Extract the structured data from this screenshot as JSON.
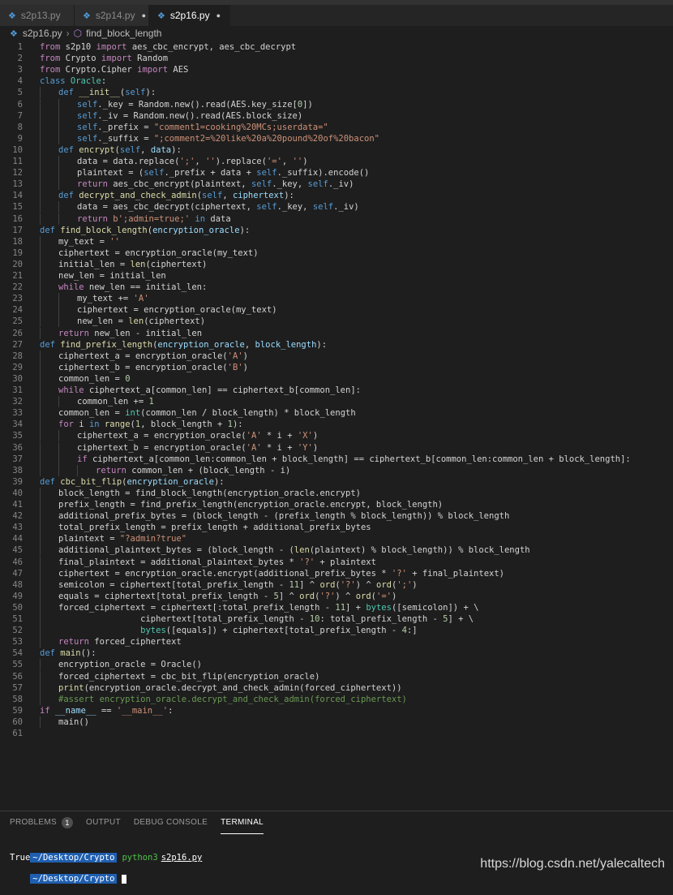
{
  "tabs": [
    {
      "label": "s2p13.py",
      "modified": false,
      "active": false
    },
    {
      "label": "s2p14.py",
      "modified": true,
      "active": false
    },
    {
      "label": "s2p16.py",
      "modified": true,
      "active": true
    }
  ],
  "breadcrumb": {
    "file": "s2p16.py",
    "symbol": "find_block_length"
  },
  "code_lines": [
    {
      "n": 1,
      "indent": 0,
      "tokens": [
        [
          "kw",
          "from"
        ],
        [
          "op",
          " s2p10 "
        ],
        [
          "kw",
          "import"
        ],
        [
          "op",
          " aes_cbc_encrypt, aes_cbc_decrypt"
        ]
      ]
    },
    {
      "n": 2,
      "indent": 0,
      "tokens": [
        [
          "kw",
          "from"
        ],
        [
          "op",
          " Crypto "
        ],
        [
          "kw",
          "import"
        ],
        [
          "op",
          " Random"
        ]
      ]
    },
    {
      "n": 3,
      "indent": 0,
      "tokens": [
        [
          "kw",
          "from"
        ],
        [
          "op",
          " Crypto.Cipher "
        ],
        [
          "kw",
          "import"
        ],
        [
          "op",
          " AES"
        ]
      ]
    },
    {
      "n": 4,
      "indent": 0,
      "tokens": [
        [
          "kw2",
          "class"
        ],
        [
          "cls",
          " Oracle"
        ],
        [
          "op",
          ":"
        ]
      ]
    },
    {
      "n": 5,
      "indent": 1,
      "tokens": [
        [
          "kw2",
          "def"
        ],
        [
          "fn",
          " __init__"
        ],
        [
          "op",
          "("
        ],
        [
          "self",
          "self"
        ],
        [
          "op",
          "):"
        ]
      ]
    },
    {
      "n": 6,
      "indent": 2,
      "tokens": [
        [
          "self",
          "self"
        ],
        [
          "op",
          "._key = Random.new().read(AES.key_size["
        ],
        [
          "num",
          "0"
        ],
        [
          "op",
          "])"
        ]
      ]
    },
    {
      "n": 7,
      "indent": 2,
      "tokens": [
        [
          "self",
          "self"
        ],
        [
          "op",
          "._iv = Random.new().read(AES.block_size)"
        ]
      ]
    },
    {
      "n": 8,
      "indent": 2,
      "tokens": [
        [
          "self",
          "self"
        ],
        [
          "op",
          "._prefix = "
        ],
        [
          "str",
          "\"comment1=cooking%20MCs;userdata=\""
        ]
      ]
    },
    {
      "n": 9,
      "indent": 2,
      "tokens": [
        [
          "self",
          "self"
        ],
        [
          "op",
          "._suffix = "
        ],
        [
          "str",
          "\";comment2=%20like%20a%20pound%20of%20bacon\""
        ]
      ]
    },
    {
      "n": 10,
      "indent": 1,
      "tokens": [
        [
          "kw2",
          "def"
        ],
        [
          "fn",
          " encrypt"
        ],
        [
          "op",
          "("
        ],
        [
          "self",
          "self"
        ],
        [
          "op",
          ", "
        ],
        [
          "var",
          "data"
        ],
        [
          "op",
          "):"
        ]
      ]
    },
    {
      "n": 11,
      "indent": 2,
      "tokens": [
        [
          "op",
          "data = data.replace("
        ],
        [
          "str",
          "';'"
        ],
        [
          "op",
          ", "
        ],
        [
          "str",
          "''"
        ],
        [
          "op",
          ").replace("
        ],
        [
          "str",
          "'='"
        ],
        [
          "op",
          ", "
        ],
        [
          "str",
          "''"
        ],
        [
          "op",
          ")"
        ]
      ]
    },
    {
      "n": 12,
      "indent": 2,
      "tokens": [
        [
          "op",
          "plaintext = ("
        ],
        [
          "self",
          "self"
        ],
        [
          "op",
          "._prefix + data + "
        ],
        [
          "self",
          "self"
        ],
        [
          "op",
          "._suffix).encode()"
        ]
      ]
    },
    {
      "n": 13,
      "indent": 2,
      "tokens": [
        [
          "kw",
          "return"
        ],
        [
          "op",
          " aes_cbc_encrypt(plaintext, "
        ],
        [
          "self",
          "self"
        ],
        [
          "op",
          "._key, "
        ],
        [
          "self",
          "self"
        ],
        [
          "op",
          "._iv)"
        ]
      ]
    },
    {
      "n": 14,
      "indent": 1,
      "tokens": [
        [
          "kw2",
          "def"
        ],
        [
          "fn",
          " decrypt_and_check_admin"
        ],
        [
          "op",
          "("
        ],
        [
          "self",
          "self"
        ],
        [
          "op",
          ", "
        ],
        [
          "var",
          "ciphertext"
        ],
        [
          "op",
          "):"
        ]
      ]
    },
    {
      "n": 15,
      "indent": 2,
      "tokens": [
        [
          "op",
          "data = aes_cbc_decrypt(ciphertext, "
        ],
        [
          "self",
          "self"
        ],
        [
          "op",
          "._key, "
        ],
        [
          "self",
          "self"
        ],
        [
          "op",
          "._iv)"
        ]
      ]
    },
    {
      "n": 16,
      "indent": 2,
      "tokens": [
        [
          "kw",
          "return"
        ],
        [
          "op",
          " "
        ],
        [
          "str",
          "b';admin=true;'"
        ],
        [
          "op",
          " "
        ],
        [
          "kw2",
          "in"
        ],
        [
          "op",
          " data"
        ]
      ]
    },
    {
      "n": 17,
      "indent": 0,
      "tokens": [
        [
          "kw2",
          "def"
        ],
        [
          "fn",
          " find_block_length"
        ],
        [
          "op",
          "("
        ],
        [
          "var",
          "encryption_oracle"
        ],
        [
          "op",
          "):"
        ]
      ]
    },
    {
      "n": 18,
      "indent": 1,
      "tokens": [
        [
          "op",
          "my_text = "
        ],
        [
          "str",
          "''"
        ]
      ]
    },
    {
      "n": 19,
      "indent": 1,
      "tokens": [
        [
          "op",
          "ciphertext = encryption_oracle(my_text)"
        ]
      ]
    },
    {
      "n": 20,
      "indent": 1,
      "tokens": [
        [
          "op",
          "initial_len = "
        ],
        [
          "fn",
          "len"
        ],
        [
          "op",
          "(ciphertext)"
        ]
      ]
    },
    {
      "n": 21,
      "indent": 1,
      "tokens": [
        [
          "op",
          "new_len = initial_len"
        ]
      ]
    },
    {
      "n": 22,
      "indent": 1,
      "tokens": [
        [
          "kw",
          "while"
        ],
        [
          "op",
          " new_len == initial_len:"
        ]
      ]
    },
    {
      "n": 23,
      "indent": 2,
      "tokens": [
        [
          "op",
          "my_text += "
        ],
        [
          "str",
          "'A'"
        ]
      ]
    },
    {
      "n": 24,
      "indent": 2,
      "tokens": [
        [
          "op",
          "ciphertext = encryption_oracle(my_text)"
        ]
      ]
    },
    {
      "n": 25,
      "indent": 2,
      "tokens": [
        [
          "op",
          "new_len = "
        ],
        [
          "fn",
          "len"
        ],
        [
          "op",
          "(ciphertext)"
        ]
      ]
    },
    {
      "n": 26,
      "indent": 1,
      "tokens": [
        [
          "kw",
          "return"
        ],
        [
          "op",
          " new_len - initial_len"
        ]
      ]
    },
    {
      "n": 27,
      "indent": 0,
      "tokens": [
        [
          "kw2",
          "def"
        ],
        [
          "fn",
          " find_prefix_length"
        ],
        [
          "op",
          "("
        ],
        [
          "var",
          "encryption_oracle"
        ],
        [
          "op",
          ", "
        ],
        [
          "var",
          "block_length"
        ],
        [
          "op",
          "):"
        ]
      ]
    },
    {
      "n": 28,
      "indent": 1,
      "tokens": [
        [
          "op",
          "ciphertext_a = encryption_oracle("
        ],
        [
          "str",
          "'A'"
        ],
        [
          "op",
          ")"
        ]
      ]
    },
    {
      "n": 29,
      "indent": 1,
      "tokens": [
        [
          "op",
          "ciphertext_b = encryption_oracle("
        ],
        [
          "str",
          "'B'"
        ],
        [
          "op",
          ")"
        ]
      ]
    },
    {
      "n": 30,
      "indent": 1,
      "tokens": [
        [
          "op",
          "common_len = "
        ],
        [
          "num",
          "0"
        ]
      ]
    },
    {
      "n": 31,
      "indent": 1,
      "tokens": [
        [
          "kw",
          "while"
        ],
        [
          "op",
          " ciphertext_a[common_len] == ciphertext_b[common_len]:"
        ]
      ]
    },
    {
      "n": 32,
      "indent": 2,
      "tokens": [
        [
          "op",
          "common_len += "
        ],
        [
          "num",
          "1"
        ]
      ]
    },
    {
      "n": 33,
      "indent": 1,
      "tokens": [
        [
          "op",
          "common_len = "
        ],
        [
          "cls",
          "int"
        ],
        [
          "op",
          "(common_len / block_length) * block_length"
        ]
      ]
    },
    {
      "n": 34,
      "indent": 1,
      "tokens": [
        [
          "kw",
          "for"
        ],
        [
          "op",
          " i "
        ],
        [
          "kw2",
          "in"
        ],
        [
          "op",
          " "
        ],
        [
          "fn",
          "range"
        ],
        [
          "op",
          "("
        ],
        [
          "num",
          "1"
        ],
        [
          "op",
          ", block_length + "
        ],
        [
          "num",
          "1"
        ],
        [
          "op",
          "):"
        ]
      ]
    },
    {
      "n": 35,
      "indent": 2,
      "tokens": [
        [
          "op",
          "ciphertext_a = encryption_oracle("
        ],
        [
          "str",
          "'A'"
        ],
        [
          "op",
          " * i + "
        ],
        [
          "str",
          "'X'"
        ],
        [
          "op",
          ")"
        ]
      ]
    },
    {
      "n": 36,
      "indent": 2,
      "tokens": [
        [
          "op",
          "ciphertext_b = encryption_oracle("
        ],
        [
          "str",
          "'A'"
        ],
        [
          "op",
          " * i + "
        ],
        [
          "str",
          "'Y'"
        ],
        [
          "op",
          ")"
        ]
      ]
    },
    {
      "n": 37,
      "indent": 2,
      "tokens": [
        [
          "kw",
          "if"
        ],
        [
          "op",
          " ciphertext_a[common_len:common_len + block_length] == ciphertext_b[common_len:common_len + block_length]:"
        ]
      ]
    },
    {
      "n": 38,
      "indent": 3,
      "tokens": [
        [
          "kw",
          "return"
        ],
        [
          "op",
          " common_len + (block_length - i)"
        ]
      ]
    },
    {
      "n": 39,
      "indent": 0,
      "tokens": [
        [
          "kw2",
          "def"
        ],
        [
          "fn",
          " cbc_bit_flip"
        ],
        [
          "op",
          "("
        ],
        [
          "var",
          "encryption_oracle"
        ],
        [
          "op",
          "):"
        ]
      ]
    },
    {
      "n": 40,
      "indent": 1,
      "tokens": [
        [
          "op",
          "block_length = find_block_length(encryption_oracle.encrypt)"
        ]
      ]
    },
    {
      "n": 41,
      "indent": 1,
      "tokens": [
        [
          "op",
          "prefix_length = find_prefix_length(encryption_oracle.encrypt, block_length)"
        ]
      ]
    },
    {
      "n": 42,
      "indent": 1,
      "tokens": [
        [
          "op",
          "additional_prefix_bytes = (block_length - (prefix_length % block_length)) % block_length"
        ]
      ]
    },
    {
      "n": 43,
      "indent": 1,
      "tokens": [
        [
          "op",
          "total_prefix_length = prefix_length + additional_prefix_bytes"
        ]
      ]
    },
    {
      "n": 44,
      "indent": 1,
      "tokens": [
        [
          "op",
          "plaintext = "
        ],
        [
          "str",
          "\"?admin?true\""
        ]
      ]
    },
    {
      "n": 45,
      "indent": 1,
      "tokens": [
        [
          "op",
          "additional_plaintext_bytes = (block_length - ("
        ],
        [
          "fn",
          "len"
        ],
        [
          "op",
          "(plaintext) % block_length)) % block_length"
        ]
      ]
    },
    {
      "n": 46,
      "indent": 1,
      "tokens": [
        [
          "op",
          "final_plaintext = additional_plaintext_bytes * "
        ],
        [
          "str",
          "'?'"
        ],
        [
          "op",
          " + plaintext"
        ]
      ]
    },
    {
      "n": 47,
      "indent": 1,
      "tokens": [
        [
          "op",
          "ciphertext = encryption_oracle.encrypt(additional_prefix_bytes * "
        ],
        [
          "str",
          "'?'"
        ],
        [
          "op",
          " + final_plaintext)"
        ]
      ]
    },
    {
      "n": 48,
      "indent": 1,
      "tokens": [
        [
          "op",
          "semicolon = ciphertext[total_prefix_length - "
        ],
        [
          "num",
          "11"
        ],
        [
          "op",
          "] ^ "
        ],
        [
          "fn",
          "ord"
        ],
        [
          "op",
          "("
        ],
        [
          "str",
          "'?'"
        ],
        [
          "op",
          ") ^ "
        ],
        [
          "fn",
          "ord"
        ],
        [
          "op",
          "("
        ],
        [
          "str",
          "';'"
        ],
        [
          "op",
          ")"
        ]
      ]
    },
    {
      "n": 49,
      "indent": 1,
      "tokens": [
        [
          "op",
          "equals = ciphertext[total_prefix_length - "
        ],
        [
          "num",
          "5"
        ],
        [
          "op",
          "] ^ "
        ],
        [
          "fn",
          "ord"
        ],
        [
          "op",
          "("
        ],
        [
          "str",
          "'?'"
        ],
        [
          "op",
          ") ^ "
        ],
        [
          "fn",
          "ord"
        ],
        [
          "op",
          "("
        ],
        [
          "str",
          "'='"
        ],
        [
          "op",
          ")"
        ]
      ]
    },
    {
      "n": 50,
      "indent": 1,
      "tokens": [
        [
          "op",
          "forced_ciphertext = ciphertext[:total_prefix_length - "
        ],
        [
          "num",
          "11"
        ],
        [
          "op",
          "] + "
        ],
        [
          "cls",
          "bytes"
        ],
        [
          "op",
          "([semicolon]) + \\"
        ]
      ]
    },
    {
      "n": 51,
      "indent": 1,
      "pad": "                ",
      "tokens": [
        [
          "op",
          "ciphertext[total_prefix_length - "
        ],
        [
          "num",
          "10"
        ],
        [
          "op",
          ": total_prefix_length - "
        ],
        [
          "num",
          "5"
        ],
        [
          "op",
          "] + \\"
        ]
      ]
    },
    {
      "n": 52,
      "indent": 1,
      "pad": "                ",
      "tokens": [
        [
          "cls",
          "bytes"
        ],
        [
          "op",
          "([equals]) + ciphertext[total_prefix_length - "
        ],
        [
          "num",
          "4"
        ],
        [
          "op",
          ":]"
        ]
      ]
    },
    {
      "n": 53,
      "indent": 1,
      "tokens": [
        [
          "kw",
          "return"
        ],
        [
          "op",
          " forced_ciphertext"
        ]
      ]
    },
    {
      "n": 54,
      "indent": 0,
      "tokens": [
        [
          "kw2",
          "def"
        ],
        [
          "fn",
          " main"
        ],
        [
          "op",
          "():"
        ]
      ]
    },
    {
      "n": 55,
      "indent": 1,
      "tokens": [
        [
          "op",
          "encryption_oracle = Oracle()"
        ]
      ]
    },
    {
      "n": 56,
      "indent": 1,
      "tokens": [
        [
          "op",
          "forced_ciphertext = cbc_bit_flip(encryption_oracle)"
        ]
      ]
    },
    {
      "n": 57,
      "indent": 1,
      "tokens": [
        [
          "fn",
          "print"
        ],
        [
          "op",
          "(encryption_oracle.decrypt_and_check_admin(forced_ciphertext))"
        ]
      ]
    },
    {
      "n": 58,
      "indent": 1,
      "tokens": [
        [
          "cmt",
          "#assert encryption_oracle.decrypt_and_check_admin(forced_ciphertext)"
        ]
      ]
    },
    {
      "n": 59,
      "indent": 0,
      "tokens": [
        [
          "kw",
          "if"
        ],
        [
          "op",
          " "
        ],
        [
          "var",
          "__name__"
        ],
        [
          "op",
          " == "
        ],
        [
          "str",
          "'__main__'"
        ],
        [
          "op",
          ":"
        ]
      ]
    },
    {
      "n": 60,
      "indent": 1,
      "tokens": [
        [
          "op",
          "main()"
        ]
      ]
    },
    {
      "n": 61,
      "indent": 0,
      "tokens": []
    }
  ],
  "panel": {
    "problems_label": "PROBLEMS",
    "problems_count": "1",
    "output_label": "OUTPUT",
    "debug_label": "DEBUG CONSOLE",
    "terminal_label": "TERMINAL"
  },
  "terminal": {
    "prompt": "~/Desktop/Crypto",
    "command": "python3",
    "arg": "s2p16.py",
    "output": "True",
    "prompt2": "~/Desktop/Crypto"
  },
  "watermark": "https://blog.csdn.net/yalecaltech",
  "colors": {
    "background": "#1e1e1e",
    "keyword": "#c586c0",
    "string": "#ce9178",
    "function": "#dcdcaa",
    "terminal_prompt": "#1f5fb0"
  }
}
